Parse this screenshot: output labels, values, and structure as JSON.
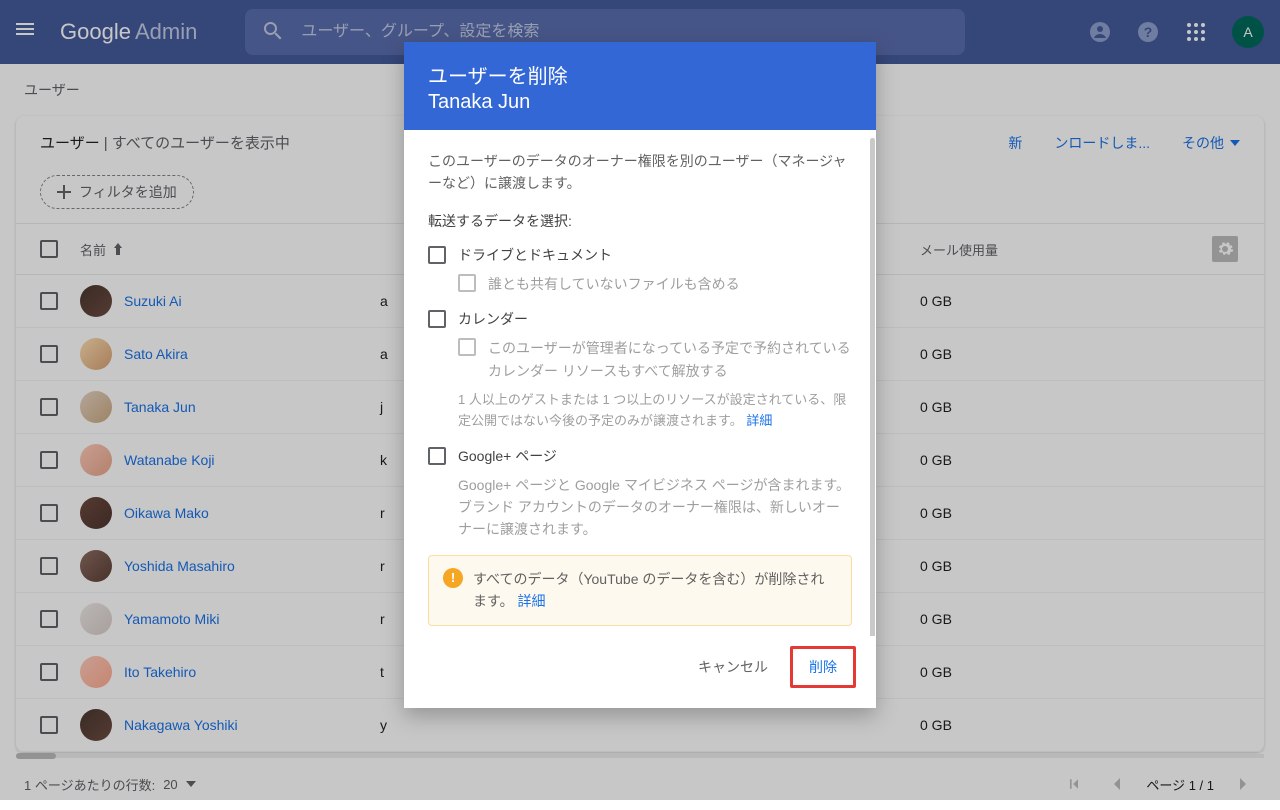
{
  "header": {
    "logo_google": "Google",
    "logo_admin": "Admin",
    "search_placeholder": "ユーザー、グループ、設定を検索",
    "avatar_letter": "A"
  },
  "breadcrumb": "ユーザー",
  "card": {
    "title_main": "ユーザー",
    "title_sub": " | すべてのユーザーを表示中",
    "action_new": "新",
    "action_download": "ンロードしま...",
    "action_other": "その他",
    "filter_label": "フィルタを追加"
  },
  "table": {
    "col_name": "名前",
    "col_usage": "メール使用量",
    "rows": [
      {
        "name": "Suzuki Ai",
        "prefix": "a",
        "usage": "0 GB"
      },
      {
        "name": "Sato Akira",
        "prefix": "a",
        "usage": "0 GB"
      },
      {
        "name": "Tanaka Jun",
        "prefix": "j",
        "usage": "0 GB"
      },
      {
        "name": "Watanabe Koji",
        "prefix": "k",
        "usage": "0 GB"
      },
      {
        "name": "Oikawa Mako",
        "prefix": "r",
        "usage": "0 GB"
      },
      {
        "name": "Yoshida Masahiro",
        "prefix": "r",
        "usage": "0 GB"
      },
      {
        "name": "Yamamoto Miki",
        "prefix": "r",
        "usage": "0 GB"
      },
      {
        "name": "Ito Takehiro",
        "prefix": "t",
        "usage": "0 GB"
      },
      {
        "name": "Nakagawa Yoshiki",
        "prefix": "y",
        "usage": "0 GB"
      }
    ]
  },
  "pagination": {
    "rows_label": "1 ページあたりの行数:",
    "rows_value": "20",
    "page_label": "ページ 1 / 1"
  },
  "dialog": {
    "title": "ユーザーを削除",
    "user": "Tanaka Jun",
    "intro": "このユーザーのデータのオーナー権限を別のユーザー（マネージャーなど）に譲渡します。",
    "select_label": "転送するデータを選択:",
    "opt_drive": "ドライブとドキュメント",
    "opt_drive_sub": "誰とも共有していないファイルも含める",
    "opt_calendar": "カレンダー",
    "opt_calendar_sub": "このユーザーが管理者になっている予定で予約されているカレンダー リソースもすべて解放する",
    "opt_calendar_note_a": "1 人以上のゲストまたは 1 つ以上のリソースが設定されている、限定公開ではない今後の予定のみが譲渡されます。 ",
    "opt_gplus": "Google+ ページ",
    "opt_gplus_sub": "Google+ ページと Google マイビジネス ページが含まれます。ブランド アカウントのデータのオーナー権限は、新しいオーナーに譲渡されます。",
    "warn_text_a": "すべてのデータ（YouTube のデータを含む）が削除されます。 ",
    "link_detail": "詳細",
    "btn_cancel": "キャンセル",
    "btn_delete": "削除"
  }
}
